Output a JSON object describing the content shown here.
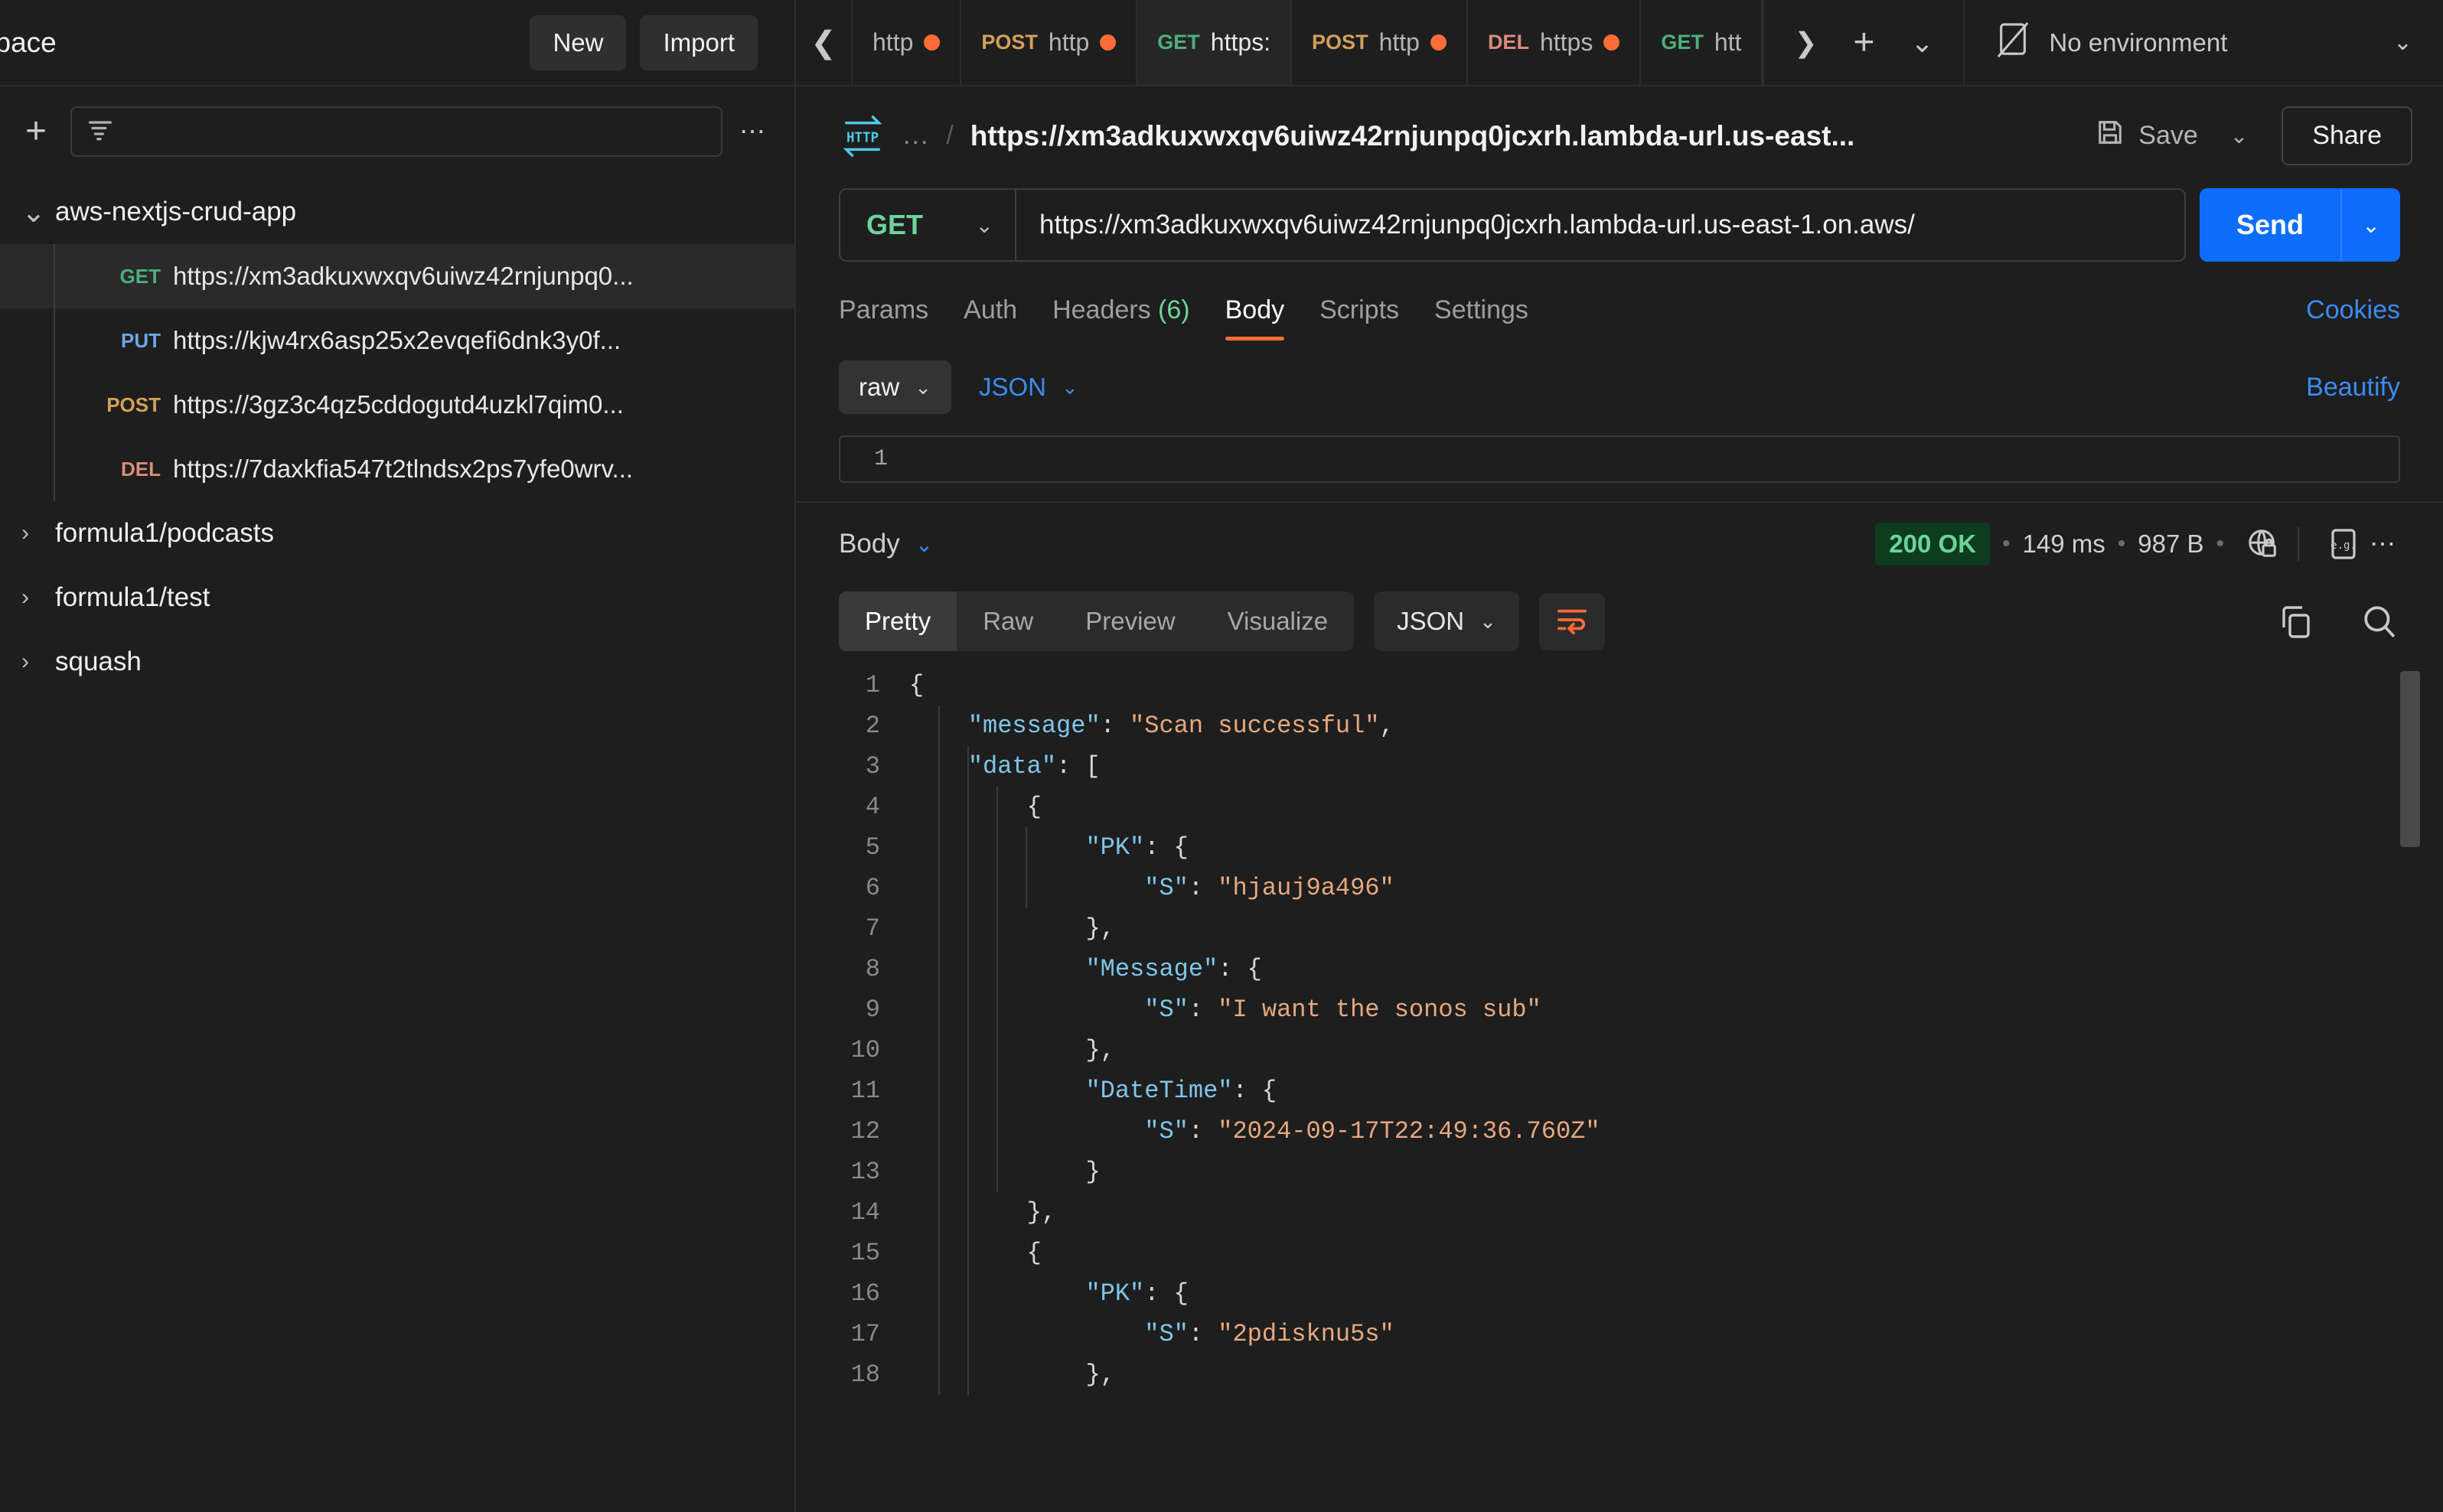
{
  "sidebar": {
    "workspace_title": "space",
    "new_label": "New",
    "import_label": "Import",
    "filter_icon": "filter-icon",
    "plus_icon": "plus-icon",
    "more_icon": "more-horizontal-icon",
    "collections": [
      {
        "name": "aws-nextjs-crud-app",
        "expanded": true,
        "requests": [
          {
            "method": "GET",
            "url": "https://xm3adkuxwxqv6uiwz42rnjunpq0...",
            "selected": true
          },
          {
            "method": "PUT",
            "url": "https://kjw4rx6asp25x2evqefi6dnk3y0f...",
            "selected": false
          },
          {
            "method": "POST",
            "url": "https://3gz3c4qz5cddogutd4uzkl7qim0...",
            "selected": false
          },
          {
            "method": "DEL",
            "url": "https://7daxkfia547t2tlndsx2ps7yfe0wrv...",
            "selected": false
          }
        ]
      },
      {
        "name": "formula1/podcasts",
        "expanded": false,
        "requests": []
      },
      {
        "name": "formula1/test",
        "expanded": false,
        "requests": []
      },
      {
        "name": "squash",
        "expanded": false,
        "requests": []
      }
    ]
  },
  "tabbar": {
    "scroll_left_icon": "chevron-left-icon",
    "scroll_right_icon": "chevron-right-icon",
    "new_tab_icon": "plus-icon",
    "tabs_dropdown_icon": "chevron-down-icon",
    "tabs": [
      {
        "method": "",
        "label": "http",
        "dirty": true,
        "active": false
      },
      {
        "method": "POST",
        "label": "http",
        "dirty": true,
        "active": false
      },
      {
        "method": "GET",
        "label": "https:",
        "dirty": false,
        "active": true
      },
      {
        "method": "POST",
        "label": "http",
        "dirty": true,
        "active": false
      },
      {
        "method": "DEL",
        "label": "https",
        "dirty": true,
        "active": false
      },
      {
        "method": "GET",
        "label": "htt",
        "dirty": false,
        "active": false
      }
    ],
    "environment": {
      "icon": "no-environment-icon",
      "label": "No environment",
      "caret_icon": "chevron-down-icon"
    }
  },
  "request": {
    "protocol_badge": "HTTP",
    "breadcrumb_ellipsis": "...",
    "breadcrumb_separator": "/",
    "title": "https://xm3adkuxwxqv6uiwz42rnjunpq0jcxrh.lambda-url.us-east...",
    "save_label": "Save",
    "save_icon": "floppy-disk-icon",
    "save_caret_icon": "chevron-down-icon",
    "share_label": "Share",
    "method": "GET",
    "method_caret_icon": "chevron-down-icon",
    "url": "https://xm3adkuxwxqv6uiwz42rnjunpq0jcxrh.lambda-url.us-east-1.on.aws/",
    "send_label": "Send",
    "send_caret_icon": "chevron-down-icon",
    "tabs": [
      {
        "label": "Params",
        "count": "",
        "active": false
      },
      {
        "label": "Auth",
        "count": "",
        "active": false
      },
      {
        "label": "Headers",
        "count": "(6)",
        "active": false
      },
      {
        "label": "Body",
        "count": "",
        "active": true
      },
      {
        "label": "Scripts",
        "count": "",
        "active": false
      },
      {
        "label": "Settings",
        "count": "",
        "active": false
      }
    ],
    "cookies_label": "Cookies",
    "body_mode": "raw",
    "body_mode_caret_icon": "chevron-down-icon",
    "body_format": "JSON",
    "body_format_caret_icon": "chevron-down-icon",
    "beautify_label": "Beautify",
    "body_editor_line": "1",
    "body_editor_content": ""
  },
  "response": {
    "body_label": "Body",
    "body_caret_icon": "chevron-down-icon",
    "status": "200 OK",
    "time": "149 ms",
    "size": "987 B",
    "dot": "•",
    "cookies_icon": "globe-lock-icon",
    "example_icon": "example-response-icon",
    "more_icon": "more-horizontal-icon",
    "view_tabs": [
      {
        "label": "Pretty",
        "active": true
      },
      {
        "label": "Raw",
        "active": false
      },
      {
        "label": "Preview",
        "active": false
      },
      {
        "label": "Visualize",
        "active": false
      }
    ],
    "format": "JSON",
    "format_caret_icon": "chevron-down-icon",
    "wrap_icon": "word-wrap-icon",
    "copy_icon": "copy-icon",
    "search_icon": "search-icon",
    "code_lines": [
      {
        "n": "1",
        "indent": 0,
        "tokens": [
          {
            "t": "p",
            "v": "{"
          }
        ]
      },
      {
        "n": "2",
        "indent": 1,
        "tokens": [
          {
            "t": "k",
            "v": "\"message\""
          },
          {
            "t": "p",
            "v": ": "
          },
          {
            "t": "s",
            "v": "\"Scan successful\""
          },
          {
            "t": "p",
            "v": ","
          }
        ]
      },
      {
        "n": "3",
        "indent": 1,
        "tokens": [
          {
            "t": "k",
            "v": "\"data\""
          },
          {
            "t": "p",
            "v": ": ["
          }
        ]
      },
      {
        "n": "4",
        "indent": 2,
        "tokens": [
          {
            "t": "p",
            "v": "{"
          }
        ]
      },
      {
        "n": "5",
        "indent": 3,
        "tokens": [
          {
            "t": "k",
            "v": "\"PK\""
          },
          {
            "t": "p",
            "v": ": {"
          }
        ]
      },
      {
        "n": "6",
        "indent": 4,
        "tokens": [
          {
            "t": "k",
            "v": "\"S\""
          },
          {
            "t": "p",
            "v": ": "
          },
          {
            "t": "s",
            "v": "\"hjauj9a496\""
          }
        ]
      },
      {
        "n": "7",
        "indent": 3,
        "tokens": [
          {
            "t": "p",
            "v": "},"
          }
        ]
      },
      {
        "n": "8",
        "indent": 3,
        "tokens": [
          {
            "t": "k",
            "v": "\"Message\""
          },
          {
            "t": "p",
            "v": ": {"
          }
        ]
      },
      {
        "n": "9",
        "indent": 4,
        "tokens": [
          {
            "t": "k",
            "v": "\"S\""
          },
          {
            "t": "p",
            "v": ": "
          },
          {
            "t": "s",
            "v": "\"I want the sonos sub\""
          }
        ]
      },
      {
        "n": "10",
        "indent": 3,
        "tokens": [
          {
            "t": "p",
            "v": "},"
          }
        ]
      },
      {
        "n": "11",
        "indent": 3,
        "tokens": [
          {
            "t": "k",
            "v": "\"DateTime\""
          },
          {
            "t": "p",
            "v": ": {"
          }
        ]
      },
      {
        "n": "12",
        "indent": 4,
        "tokens": [
          {
            "t": "k",
            "v": "\"S\""
          },
          {
            "t": "p",
            "v": ": "
          },
          {
            "t": "s",
            "v": "\"2024-09-17T22:49:36.760Z\""
          }
        ]
      },
      {
        "n": "13",
        "indent": 3,
        "tokens": [
          {
            "t": "p",
            "v": "}"
          }
        ]
      },
      {
        "n": "14",
        "indent": 2,
        "tokens": [
          {
            "t": "p",
            "v": "},"
          }
        ]
      },
      {
        "n": "15",
        "indent": 2,
        "tokens": [
          {
            "t": "p",
            "v": "{"
          }
        ]
      },
      {
        "n": "16",
        "indent": 3,
        "tokens": [
          {
            "t": "k",
            "v": "\"PK\""
          },
          {
            "t": "p",
            "v": ": {"
          }
        ]
      },
      {
        "n": "17",
        "indent": 4,
        "tokens": [
          {
            "t": "k",
            "v": "\"S\""
          },
          {
            "t": "p",
            "v": ": "
          },
          {
            "t": "s",
            "v": "\"2pdisknu5s\""
          }
        ]
      },
      {
        "n": "18",
        "indent": 3,
        "tokens": [
          {
            "t": "p",
            "v": "},"
          }
        ]
      }
    ]
  },
  "colors": {
    "accent_orange": "#ff6c37",
    "blue": "#3b8cf0",
    "send_blue": "#0d6efd",
    "get_green": "#4caf7d",
    "post_orange": "#d3a05a",
    "put_blue": "#6ba6e8",
    "del_red": "#d98b7a",
    "status_green": "#6dd49a",
    "json_key": "#7fc6e8",
    "json_string": "#e8a87f"
  }
}
